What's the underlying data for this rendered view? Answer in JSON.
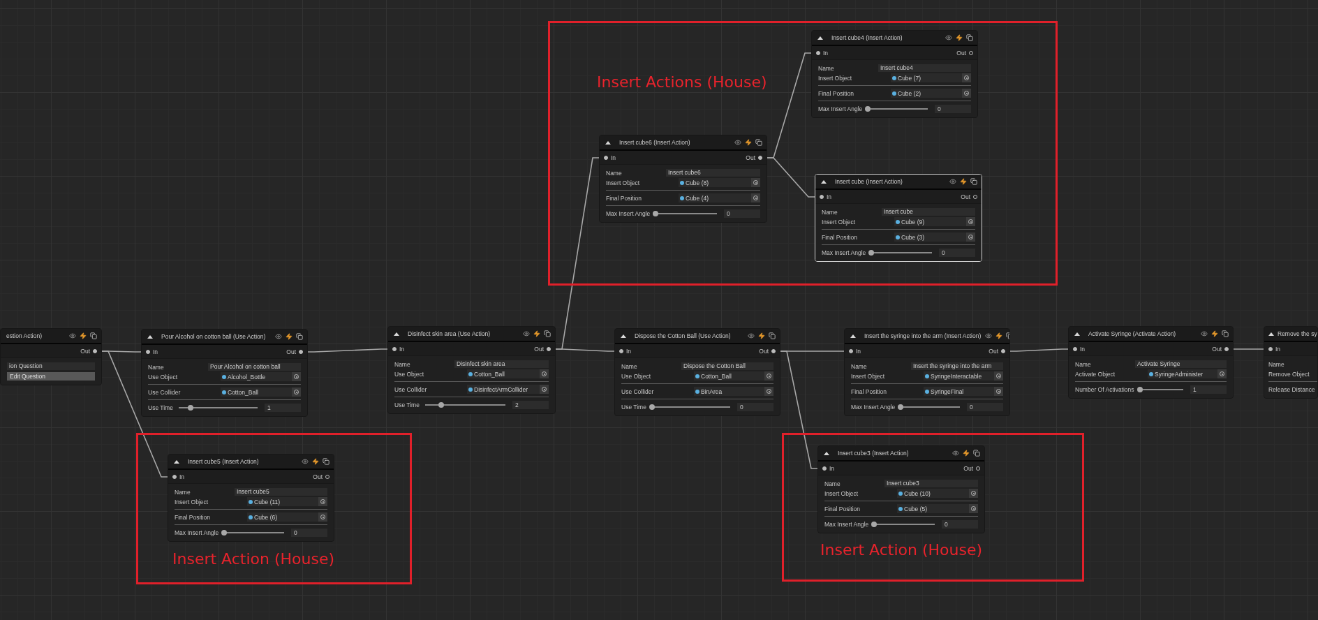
{
  "annotations": [
    {
      "label": "Insert Actions (House)"
    },
    {
      "label": "Insert Action (House)"
    },
    {
      "label": "Insert Action (House)"
    }
  ],
  "nodes": [
    {
      "title": "estion Action)",
      "selected": false,
      "out": "Out",
      "out_connected": true,
      "fields": [
        {
          "kind": "text",
          "value": "ion Question"
        },
        {
          "kind": "button",
          "label": "Edit Question"
        }
      ]
    },
    {
      "title": "Pour Alcohol on cotton ball (Use Action)",
      "selected": false,
      "in": "In",
      "out": "Out",
      "out_connected": true,
      "fields": [
        {
          "kind": "text",
          "label": "Name",
          "value": "Pour Alcohol on cotton ball"
        },
        {
          "kind": "object",
          "label": "Use Object",
          "value": "Alcohol_Bottle"
        },
        {
          "kind": "object",
          "label": "Use Collider",
          "value": "Cotton_Ball"
        },
        {
          "kind": "slider",
          "label": "Use Time",
          "level": 0.15,
          "value": "1"
        }
      ]
    },
    {
      "title": "Disinfect skin area (Use Action)",
      "selected": false,
      "in": "In",
      "out": "Out",
      "out_connected": true,
      "fields": [
        {
          "kind": "text",
          "label": "Name",
          "value": "Disinfect skin area"
        },
        {
          "kind": "object",
          "label": "Use Object",
          "value": "Cotton_Ball"
        },
        {
          "kind": "object",
          "label": "Use Collider",
          "value": "DisinfectArmCollider"
        },
        {
          "kind": "slider",
          "label": "Use Time",
          "level": 0.2,
          "value": "2"
        }
      ]
    },
    {
      "title": "Dispose the Cotton Ball (Use Action)",
      "selected": false,
      "in": "In",
      "out": "Out",
      "out_connected": true,
      "fields": [
        {
          "kind": "text",
          "label": "Name",
          "value": "Dispose the Cotton Ball"
        },
        {
          "kind": "object",
          "label": "Use Object",
          "value": "Cotton_Ball"
        },
        {
          "kind": "object",
          "label": "Use Collider",
          "value": "BinArea"
        },
        {
          "kind": "slider",
          "label": "Use Time",
          "level": 0,
          "value": "0"
        }
      ]
    },
    {
      "title": "Insert the syringe into the arm (Insert Action)",
      "selected": false,
      "in": "In",
      "out": "Out",
      "out_connected": true,
      "fields": [
        {
          "kind": "text",
          "label": "Name",
          "value": "Insert the syringe into the arm"
        },
        {
          "kind": "object",
          "label": "Insert Object",
          "value": "SyringeInteractable"
        },
        {
          "kind": "object",
          "label": "Final Position",
          "value": "SyringeFinal"
        },
        {
          "kind": "slider",
          "label": "Max Insert Angle",
          "level": 0,
          "value": "0"
        }
      ]
    },
    {
      "title": "Activate Syringe (Activate Action)",
      "selected": false,
      "in": "In",
      "out": "Out",
      "out_connected": true,
      "fields": [
        {
          "kind": "text",
          "label": "Name",
          "value": "Activate Syringe"
        },
        {
          "kind": "object",
          "label": "Activate Object",
          "value": "SyringeAdminister"
        },
        {
          "kind": "slider",
          "label": "Number Of Activations",
          "level": 0,
          "value": "1"
        }
      ]
    },
    {
      "title": "Remove the sy",
      "selected": false,
      "in": "In",
      "fields": [
        {
          "kind": "text",
          "label": "Name"
        },
        {
          "kind": "object",
          "label": "Remove Object"
        },
        {
          "kind": "slider",
          "label": "Release Distance"
        }
      ]
    },
    {
      "title": "Insert cube6 (Insert Action)",
      "selected": false,
      "in": "In",
      "out": "Out",
      "out_connected": true,
      "fields": [
        {
          "kind": "text",
          "label": "Name",
          "value": "Insert cube6"
        },
        {
          "kind": "object",
          "label": "Insert Object",
          "value": "Cube (8)"
        },
        {
          "kind": "object",
          "label": "Final Position",
          "value": "Cube (4)"
        },
        {
          "kind": "slider",
          "label": "Max Insert Angle",
          "level": 0,
          "value": "0"
        }
      ]
    },
    {
      "title": "Insert cube4 (Insert Action)",
      "selected": false,
      "in": "In",
      "out": "Out",
      "out_connected": false,
      "fields": [
        {
          "kind": "text",
          "label": "Name",
          "value": "Insert cube4"
        },
        {
          "kind": "object",
          "label": "Insert Object",
          "value": "Cube (7)"
        },
        {
          "kind": "object",
          "label": "Final Position",
          "value": "Cube (2)"
        },
        {
          "kind": "slider",
          "label": "Max Insert Angle",
          "level": 0,
          "value": "0"
        }
      ]
    },
    {
      "title": "Insert cube (Insert Action)",
      "selected": true,
      "in": "In",
      "out": "Out",
      "out_connected": false,
      "fields": [
        {
          "kind": "text",
          "label": "Name",
          "value": "Insert cube"
        },
        {
          "kind": "object",
          "label": "Insert Object",
          "value": "Cube (9)"
        },
        {
          "kind": "object",
          "label": "Final Position",
          "value": "Cube (3)"
        },
        {
          "kind": "slider",
          "label": "Max Insert Angle",
          "level": 0,
          "value": "0"
        }
      ]
    },
    {
      "title": "Insert cube5 (Insert Action)",
      "selected": false,
      "in": "In",
      "out": "Out",
      "out_connected": false,
      "fields": [
        {
          "kind": "text",
          "label": "Name",
          "value": "Insert cube5"
        },
        {
          "kind": "object",
          "label": "Insert Object",
          "value": "Cube (11)"
        },
        {
          "kind": "object",
          "label": "Final Position",
          "value": "Cube (6)"
        },
        {
          "kind": "slider",
          "label": "Max Insert Angle",
          "level": 0,
          "value": "0"
        }
      ]
    },
    {
      "title": "Insert cube3 (Insert Action)",
      "selected": false,
      "in": "In",
      "out": "Out",
      "out_connected": false,
      "fields": [
        {
          "kind": "text",
          "label": "Name",
          "value": "Insert cube3"
        },
        {
          "kind": "object",
          "label": "Insert Object",
          "value": "Cube (10)"
        },
        {
          "kind": "object",
          "label": "Final Position",
          "value": "Cube (5)"
        },
        {
          "kind": "slider",
          "label": "Max Insert Angle",
          "level": 0,
          "value": "0"
        }
      ]
    }
  ]
}
